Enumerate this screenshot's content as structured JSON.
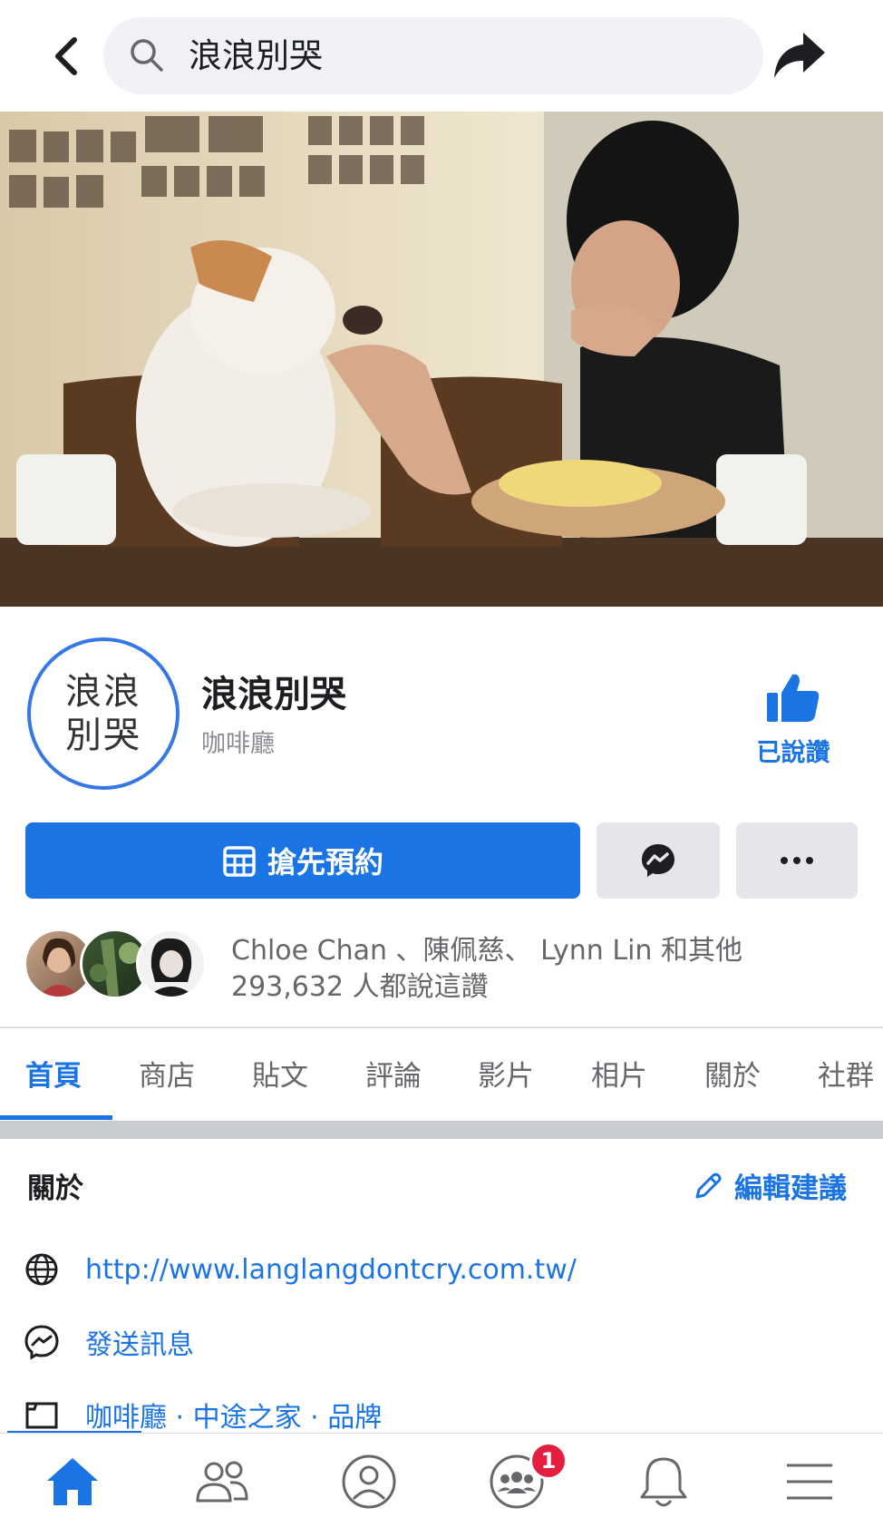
{
  "search": {
    "query": "浪浪別哭"
  },
  "profile": {
    "avatar_text_line1": "浪浪",
    "avatar_text_line2": "別哭",
    "name": "浪浪別哭",
    "category": "咖啡廳",
    "liked_label": "已說讚"
  },
  "actions": {
    "cta_label": "搶先預約"
  },
  "likes": {
    "line1": "Chloe Chan 、陳佩慈、 Lynn Lin 和其他",
    "line2": "293,632 人都說這讚"
  },
  "tabs": [
    {
      "label": "首頁",
      "active": true
    },
    {
      "label": "商店"
    },
    {
      "label": "貼文"
    },
    {
      "label": "評論"
    },
    {
      "label": "影片"
    },
    {
      "label": "相片"
    },
    {
      "label": "關於"
    },
    {
      "label": "社群"
    }
  ],
  "about": {
    "title": "關於",
    "edit_label": "編輯建議",
    "website": "http://www.langlangdontcry.com.tw/",
    "message": "發送訊息",
    "categories": "咖啡廳 · 中途之家 · 品牌"
  },
  "bottom_nav": {
    "groups_badge": "1"
  },
  "colors": {
    "accent": "#1b74e4",
    "badge": "#e41e3f",
    "button_gray": "#e4e6eb"
  }
}
